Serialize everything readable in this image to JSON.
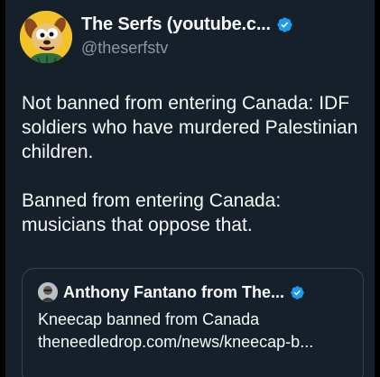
{
  "author": {
    "display_name": "The Serfs (youtube.c...",
    "handle": "@theserfstv",
    "verified": true,
    "avatar_icon": "cartoon-dog-avatar"
  },
  "tweet": {
    "paragraphs": [
      "Not banned from entering Canada: IDF soldiers who have murdered Palestinian children.",
      "Banned from entering Canada: musicians that oppose that."
    ]
  },
  "quoted_tweet": {
    "author": "Anthony Fantano from The...",
    "verified": true,
    "text_line1": "Kneecap banned from Canada",
    "text_line2": "theneedledrop.com/news/kneecap-b..."
  },
  "colors": {
    "background": "#15202b",
    "text": "#f7f9f9",
    "secondary_text": "#8b98a5",
    "verified_blue": "#1d9bf0",
    "border": "#38444d"
  }
}
